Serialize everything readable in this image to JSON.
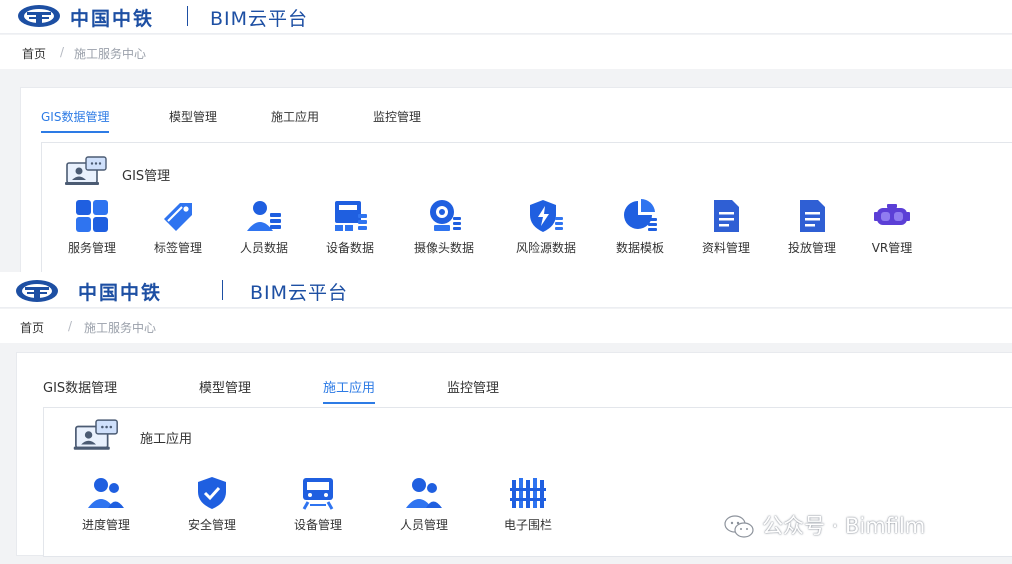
{
  "theme": {
    "brand": "#1d4fa3",
    "accent": "#2d7be5",
    "icon_blue": "#1f5fe0",
    "icon_purple": "#5b3fd6"
  },
  "panels": [
    {
      "brand": {
        "company": "中国中铁",
        "platform": "BIM云平台"
      },
      "breadcrumb": {
        "home": "首页",
        "sep": "/",
        "current": "施工服务中心"
      },
      "tabs": [
        {
          "label": "GIS数据管理",
          "active": true
        },
        {
          "label": "模型管理",
          "active": false
        },
        {
          "label": "施工应用",
          "active": false
        },
        {
          "label": "监控管理",
          "active": false
        }
      ],
      "section": {
        "title": "GIS管理",
        "icon": "monitor-chat-icon"
      },
      "apps": [
        {
          "label": "服务管理",
          "icon": "grid-icon"
        },
        {
          "label": "标签管理",
          "icon": "tag-icon"
        },
        {
          "label": "人员数据",
          "icon": "user-list-icon"
        },
        {
          "label": "设备数据",
          "icon": "device-list-icon"
        },
        {
          "label": "摄像头数据",
          "icon": "camera-list-icon"
        },
        {
          "label": "风险源数据",
          "icon": "shield-bolt-icon"
        },
        {
          "label": "数据模板",
          "icon": "pie-list-icon"
        },
        {
          "label": "资料管理",
          "icon": "document-icon"
        },
        {
          "label": "投放管理",
          "icon": "document-icon"
        },
        {
          "label": "VR管理",
          "icon": "vr-headset-icon"
        }
      ]
    },
    {
      "brand": {
        "company": "中国中铁",
        "platform": "BIM云平台"
      },
      "breadcrumb": {
        "home": "首页",
        "sep": "/",
        "current": "施工服务中心"
      },
      "tabs": [
        {
          "label": "GIS数据管理",
          "active": false
        },
        {
          "label": "模型管理",
          "active": false
        },
        {
          "label": "施工应用",
          "active": true
        },
        {
          "label": "监控管理",
          "active": false
        }
      ],
      "section": {
        "title": "施工应用",
        "icon": "monitor-chat-icon"
      },
      "apps": [
        {
          "label": "进度管理",
          "icon": "users-icon"
        },
        {
          "label": "安全管理",
          "icon": "shield-check-icon"
        },
        {
          "label": "设备管理",
          "icon": "train-icon"
        },
        {
          "label": "人员管理",
          "icon": "users-icon"
        },
        {
          "label": "电子围栏",
          "icon": "fence-icon"
        }
      ]
    }
  ],
  "watermark": {
    "text": "公众号 · Bimfilm",
    "icon": "wechat-icon"
  }
}
